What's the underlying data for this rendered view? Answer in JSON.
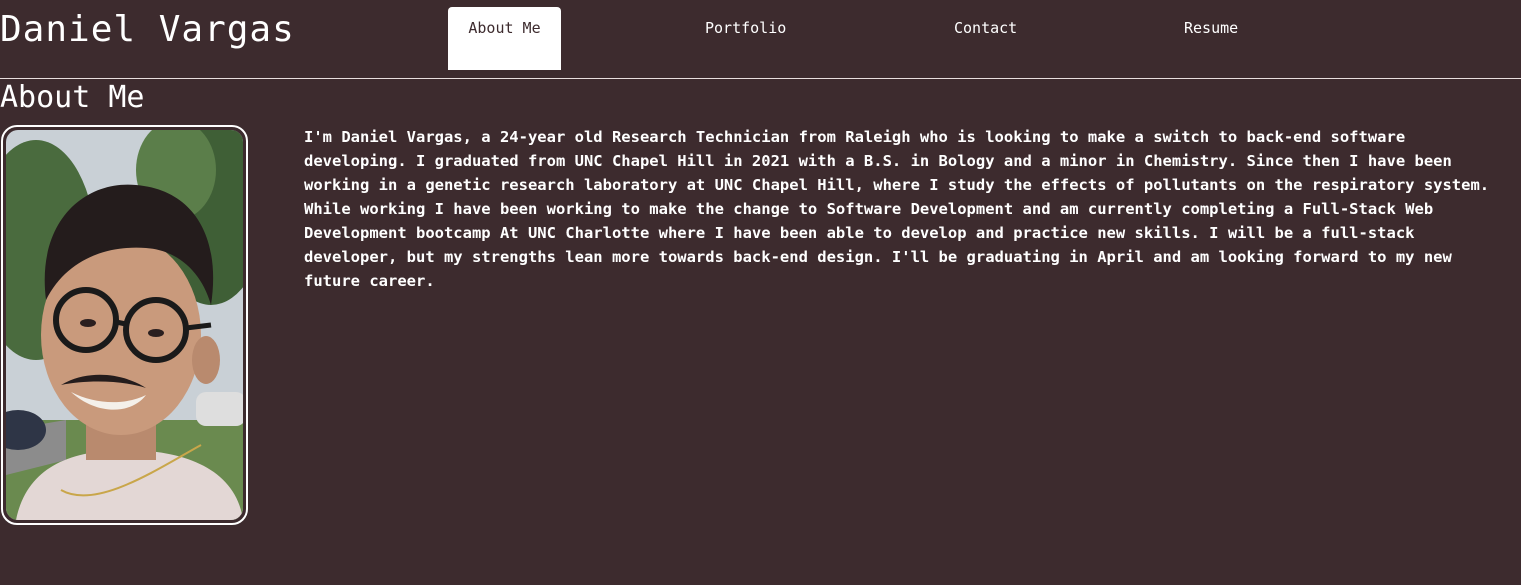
{
  "header": {
    "site_name": "Daniel Vargas"
  },
  "nav": {
    "tabs": [
      {
        "label": "About Me",
        "active": true
      },
      {
        "label": "Portfolio",
        "active": false
      },
      {
        "label": "Contact",
        "active": false
      },
      {
        "label": "Resume",
        "active": false
      }
    ]
  },
  "about": {
    "title": "About Me",
    "bio": "I'm Daniel Vargas, a 24-year old Research Technician from Raleigh who is looking to make a switch to back-end software developing. I graduated from UNC Chapel Hill in 2021 with a B.S. in Bology and a minor in Chemistry. Since then I have been working in a genetic research laboratory at UNC Chapel Hill, where I study the effects of pollutants on the respiratory system. While working I have been working to make the change to Software Development and am currently completing a Full-Stack Web Development bootcamp At UNC Charlotte where I have been able to develop and practice new skills. I will be a full-stack developer, but my strengths lean more towards back-end design. I'll be graduating in April and am looking forward to my new future career."
  },
  "colors": {
    "background": "#3d2b2e",
    "text": "#ffffff",
    "active_tab_bg": "#ffffff",
    "active_tab_text": "#3d2b2e"
  }
}
